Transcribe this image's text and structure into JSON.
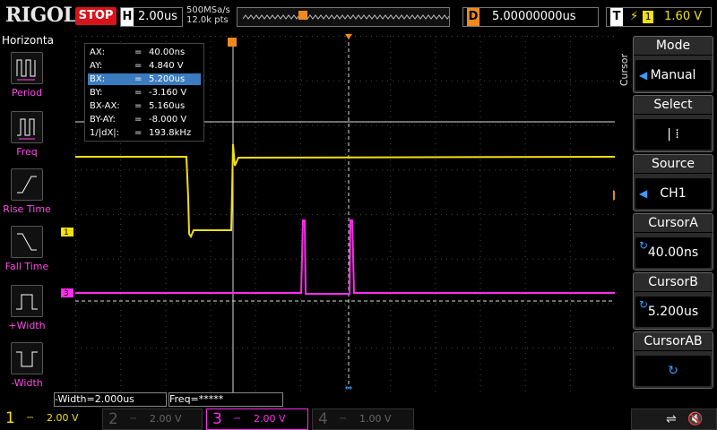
{
  "header": {
    "logo": "RIGOL",
    "run_state": "STOP",
    "horizontal_label": "H",
    "timebase": "2.00us",
    "sample_rate": "500MSa/s",
    "points": "12.0k pts",
    "delay_label": "D",
    "delay": "5.00000000us",
    "trigger_label": "T",
    "trigger_source": "1",
    "trigger_level": "1.60 V"
  },
  "left_menu": {
    "title": "Horizontal",
    "items": [
      {
        "label": "Period",
        "icon": "period-icon"
      },
      {
        "label": "Freq",
        "icon": "frequency-icon"
      },
      {
        "label": "Rise Time",
        "icon": "rise-time-icon"
      },
      {
        "label": "Fall Time",
        "icon": "fall-time-icon"
      },
      {
        "label": "+Width",
        "icon": "positive-width-icon"
      },
      {
        "label": "-Width",
        "icon": "negative-width-icon"
      }
    ]
  },
  "cursor_readout": {
    "rows": [
      {
        "key": "AX:",
        "eq": "=",
        "value": "40.00ns"
      },
      {
        "key": "AY:",
        "eq": "=",
        "value": "4.840 V"
      },
      {
        "key": "BX:",
        "eq": "=",
        "value": "5.200us"
      },
      {
        "key": "BY:",
        "eq": "=",
        "value": "-3.160 V"
      },
      {
        "key": "BX-AX:",
        "eq": "=",
        "value": "5.160us"
      },
      {
        "key": "BY-AY:",
        "eq": "=",
        "value": "-8.000 V"
      },
      {
        "key": "1/|dX|:",
        "eq": "=",
        "value": "193.8kHz"
      }
    ]
  },
  "right_menu": {
    "title": "Cursor",
    "mode_label": "Mode",
    "mode_value": "Manual",
    "select_label": "Select",
    "select_value": "| ⁞",
    "source_label": "Source",
    "source_value": "CH1",
    "cursor_a_label": "CursorA",
    "cursor_a_value": "40.00ns",
    "cursor_b_label": "CursorB",
    "cursor_b_value": "5.200us",
    "cursor_ab_label": "CursorAB"
  },
  "measurements": {
    "neg_width": "-Width=2.000us",
    "freq": "Freq=*****"
  },
  "channels": [
    {
      "num": "1",
      "coupling": "⎓",
      "scale": "2.00 V",
      "color": "#f4e00e",
      "active": true
    },
    {
      "num": "2",
      "coupling": "⎓",
      "scale": "2.00 V",
      "color": "#00c8ff",
      "active": false
    },
    {
      "num": "3",
      "coupling": "⎓",
      "scale": "2.00 V",
      "color": "#ff2cf0",
      "active": true
    },
    {
      "num": "4",
      "coupling": "⎓",
      "scale": "1.00 V",
      "color": "#3355ff",
      "active": false
    }
  ],
  "markers": {
    "ch1": "1",
    "ch3": "3",
    "trigger_time": "T",
    "trigger_level": "T"
  },
  "colors": {
    "ch1": "#f4e00e",
    "ch3": "#ff2cf0",
    "trigger": "#f08a1c",
    "accent": "#3b7cc0"
  }
}
